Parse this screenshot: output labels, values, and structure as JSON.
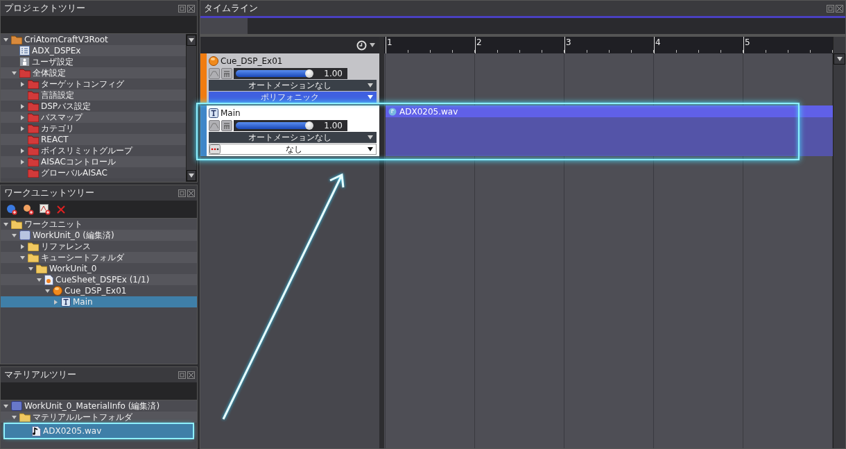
{
  "project_tree": {
    "title": "プロジェクトツリー",
    "items": [
      {
        "label": "CriAtomCraftV3Root",
        "kind": "root-folder",
        "expanded": true,
        "children": [
          {
            "label": "ADX_DSPEx",
            "kind": "project"
          },
          {
            "label": "ユーザ設定",
            "kind": "user"
          },
          {
            "label": "全体設定",
            "kind": "red-folder",
            "expanded": true,
            "children": [
              {
                "label": "ターゲットコンフィグ",
                "kind": "red-folder",
                "expanded": false
              },
              {
                "label": "言語設定",
                "kind": "red-folder"
              },
              {
                "label": "DSPバス設定",
                "kind": "red-folder",
                "expanded": false
              },
              {
                "label": "バスマップ",
                "kind": "red-folder",
                "expanded": false
              },
              {
                "label": "カテゴリ",
                "kind": "red-folder",
                "expanded": false
              },
              {
                "label": "REACT",
                "kind": "red-folder"
              },
              {
                "label": "ボイスリミットグループ",
                "kind": "red-folder",
                "expanded": false
              },
              {
                "label": "AISACコントロール",
                "kind": "red-folder",
                "expanded": false
              },
              {
                "label": "グローバルAISAC",
                "kind": "red-folder"
              }
            ]
          }
        ]
      }
    ]
  },
  "workunit_tree": {
    "title": "ワークユニットツリー",
    "items": [
      {
        "label": "ワークユニット",
        "kind": "folder",
        "expanded": true,
        "selected": false,
        "children": [
          {
            "label": "WorkUnit_0 (編集済)",
            "kind": "workunit",
            "expanded": true,
            "selected": false,
            "children": [
              {
                "label": "リファレンス",
                "kind": "folder",
                "expanded": false,
                "selected": false
              },
              {
                "label": "キューシートフォルダ",
                "kind": "folder",
                "expanded": true,
                "selected": false,
                "children": [
                  {
                    "label": "WorkUnit_0",
                    "kind": "folder",
                    "expanded": true,
                    "selected": false,
                    "children": [
                      {
                        "label": "CueSheet_DSPEx (1/1)",
                        "kind": "cuesheet",
                        "expanded": true,
                        "selected": false,
                        "children": [
                          {
                            "label": "Cue_DSP_Ex01",
                            "kind": "cue",
                            "expanded": true,
                            "selected": false,
                            "children": [
                              {
                                "label": "Main",
                                "kind": "track",
                                "expanded": false,
                                "selected": true
                              }
                            ]
                          }
                        ]
                      }
                    ]
                  }
                ]
              }
            ]
          }
        ]
      }
    ]
  },
  "material_tree": {
    "title": "マテリアルツリー",
    "items": [
      {
        "label": "WorkUnit_0_MaterialInfo (編集済)",
        "kind": "material-info",
        "expanded": true,
        "selected": false,
        "children": [
          {
            "label": "マテリアルルートフォルダ",
            "kind": "folder",
            "expanded": true,
            "selected": false,
            "children": [
              {
                "label": "ADX0205.wav",
                "kind": "wave",
                "selected": true
              }
            ]
          }
        ]
      }
    ]
  },
  "timeline": {
    "title": "タイムライン",
    "ruler": [
      "1",
      "2",
      "3",
      "4",
      "5"
    ],
    "tracks": [
      {
        "kind": "cue",
        "name": "Cue_DSP_Ex01",
        "level": 0.95,
        "volume": "1.00",
        "automation": "オートメーションなし",
        "mode": "ポリフォニック"
      },
      {
        "kind": "track",
        "name": "Main",
        "level": 0.95,
        "volume": "1.00",
        "automation": "オートメーションなし",
        "mode": "なし"
      }
    ],
    "clips": [
      {
        "name": "ADX0205.wav"
      }
    ]
  }
}
